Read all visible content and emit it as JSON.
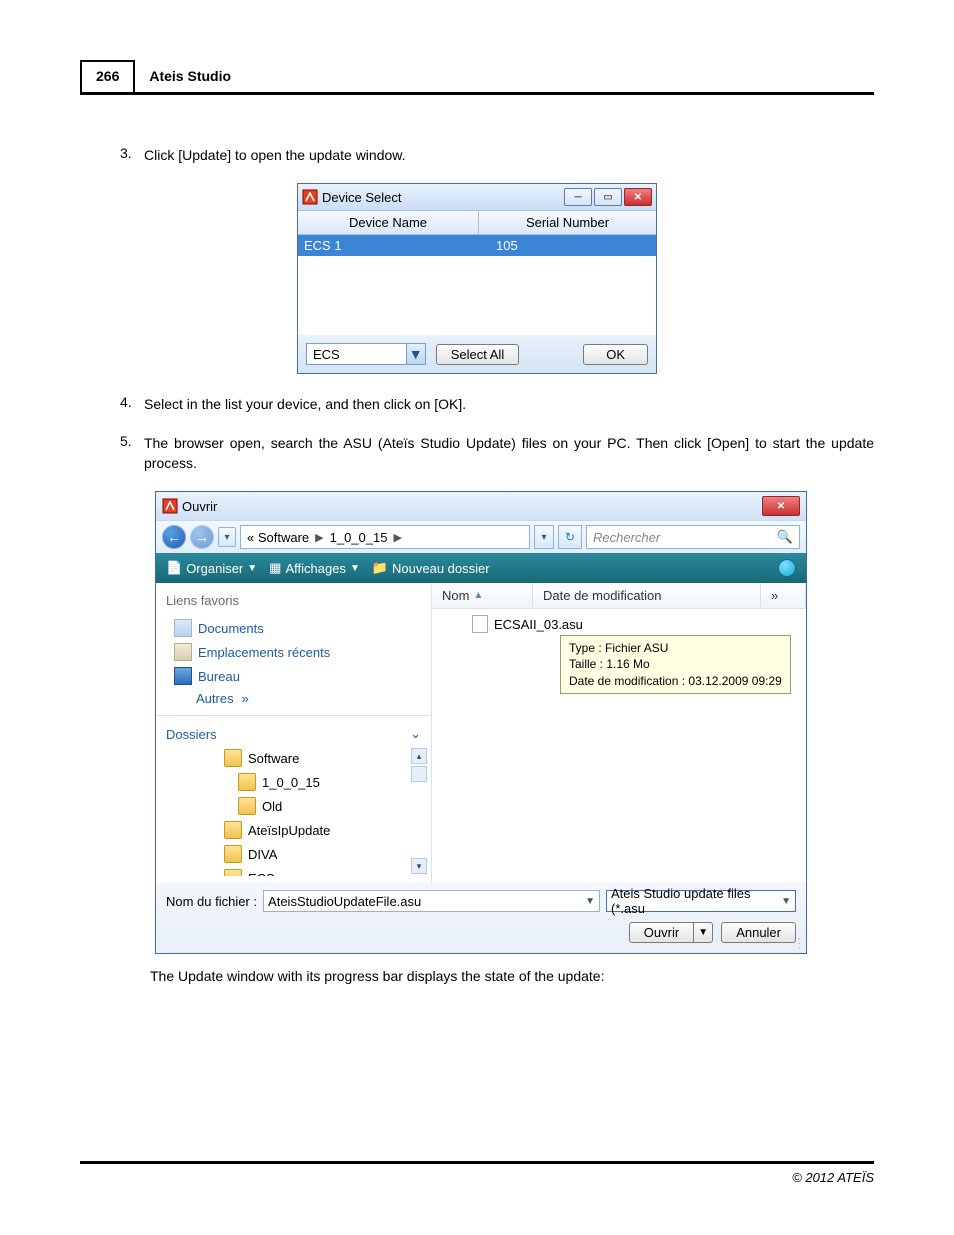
{
  "header": {
    "page_number": "266",
    "title": "Ateis Studio"
  },
  "steps": {
    "s3": {
      "num": "3.",
      "text": "Click [Update] to open the update window."
    },
    "s4": {
      "num": "4.",
      "text": "Select in the list your device, and then click on [OK]."
    },
    "s5": {
      "num": "5.",
      "text": "The browser open, search the ASU (Ateïs Studio Update) files on your PC. Then click [Open] to start the update process."
    }
  },
  "device_select": {
    "title": "Device Select",
    "col_device": "Device Name",
    "col_serial": "Serial Number",
    "row_device": "ECS 1",
    "row_serial": "105",
    "combo": "ECS",
    "select_all": "Select All",
    "ok": "OK"
  },
  "open_dialog": {
    "title": "Ouvrir",
    "path_prefix": "«  Software",
    "path_folder": "1_0_0_15",
    "search_placeholder": "Rechercher",
    "tb_organiser": "Organiser",
    "tb_affichages": "Affichages",
    "tb_nouveau": "Nouveau dossier",
    "lp_favoris": "Liens favoris",
    "lp_documents": "Documents",
    "lp_recents": "Emplacements récents",
    "lp_bureau": "Bureau",
    "lp_autres": "Autres",
    "lp_dossiers": "Dossiers",
    "tree": {
      "software": "Software",
      "ver": "1_0_0_15",
      "old": "Old",
      "upd": "AteïsIpUpdate",
      "diva": "DIVA",
      "ecs": "ECS"
    },
    "col_nom": "Nom",
    "col_date": "Date de modification",
    "file_name": "ECSAII_03.asu",
    "tooltip_type": "Type : Fichier ASU",
    "tooltip_size": "Taille : 1.16 Mo",
    "tooltip_date": "Date de modification : 03.12.2009 09:29",
    "fn_label": "Nom du fichier :",
    "fn_value": "AteisStudioUpdateFile.asu",
    "type_filter": "Ateis Studio update files (*.asu",
    "open": "Ouvrir",
    "cancel": "Annuler"
  },
  "after": "The Update window with its progress bar displays the state of the update:",
  "footer": "© 2012 ATEÏS"
}
